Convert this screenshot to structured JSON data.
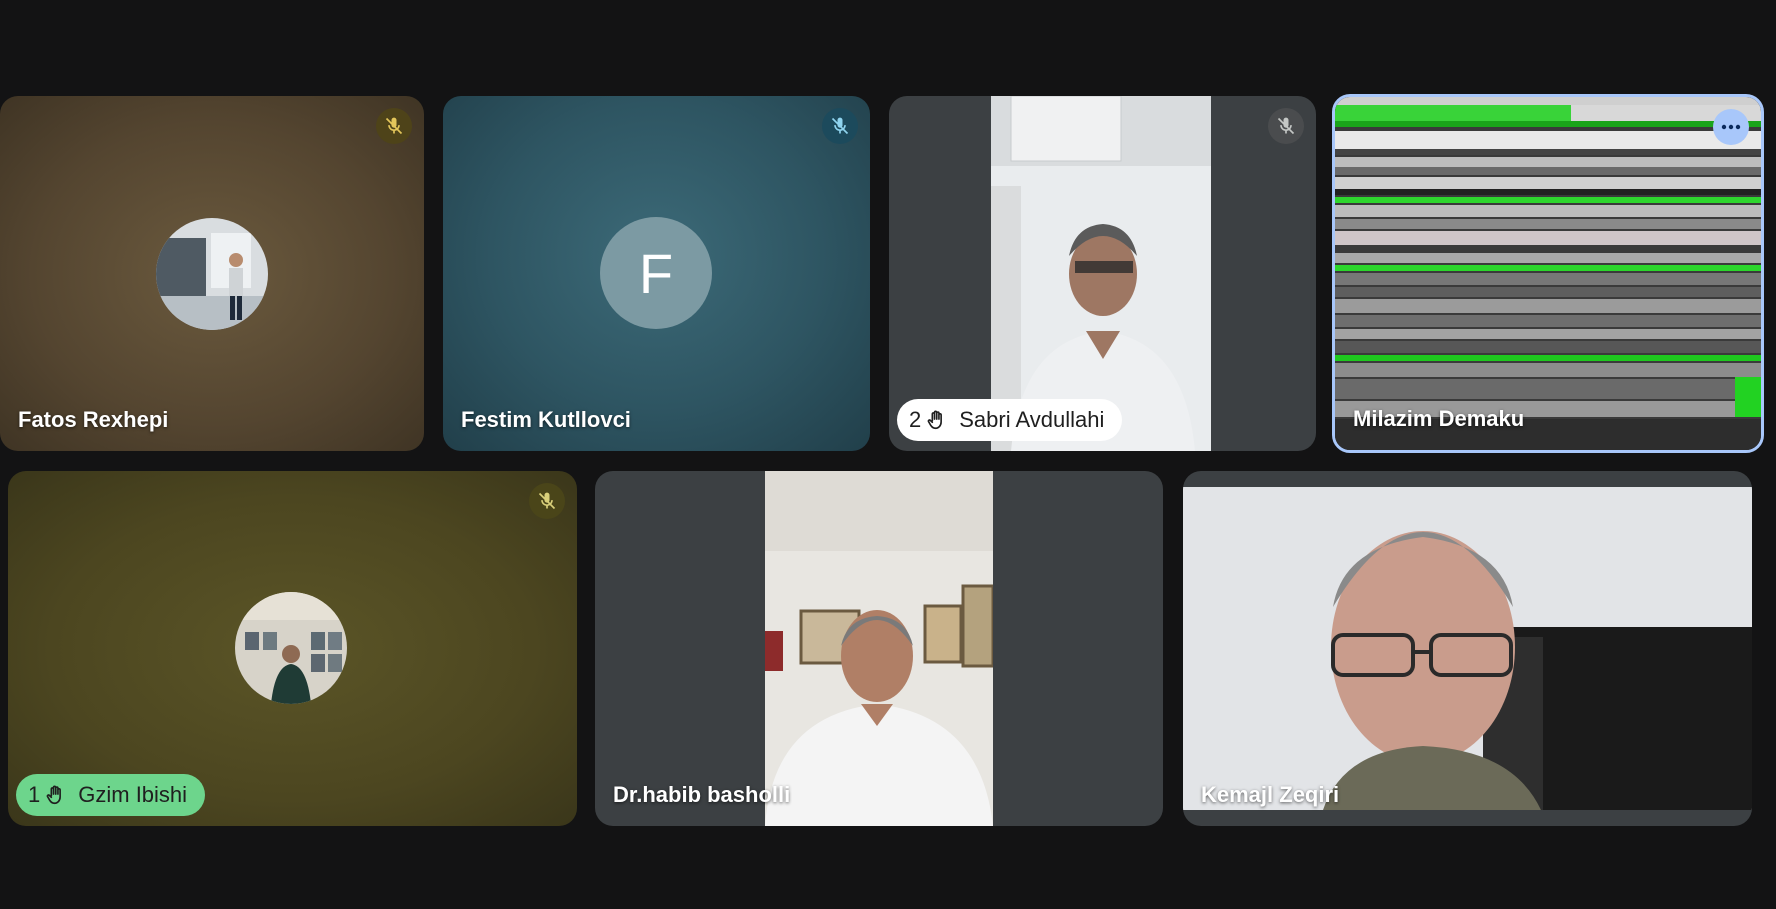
{
  "participants": [
    {
      "name": "Fatos Rexhepi",
      "muted": true,
      "mute_color": "#4e4319",
      "tile_color": "#5a4a33"
    },
    {
      "name": "Festim Kutllovci",
      "muted": true,
      "avatar_letter": "F",
      "mute_color": "#1c4a5c",
      "tile_color": "#2f5562"
    },
    {
      "name": "Sabri Avdullahi",
      "muted": true,
      "hand_raise_order": "2",
      "mute_color": "#4a4c4e"
    },
    {
      "name": "Milazim Demaku",
      "pinned_active": true,
      "more_options_icon": "more-horiz-icon"
    },
    {
      "name": "Gzim Ibishi",
      "muted": true,
      "hand_raise_order": "1",
      "mute_color": "#4a4519"
    },
    {
      "name": "Dr.habib basholli"
    },
    {
      "name": "Kemajl Zeqiri"
    }
  ],
  "colors": {
    "background": "#131314",
    "active_border": "#a8c7fa",
    "hand_raise_pill_active": "#6dd58c",
    "hand_raise_pill": "#ffffff"
  }
}
